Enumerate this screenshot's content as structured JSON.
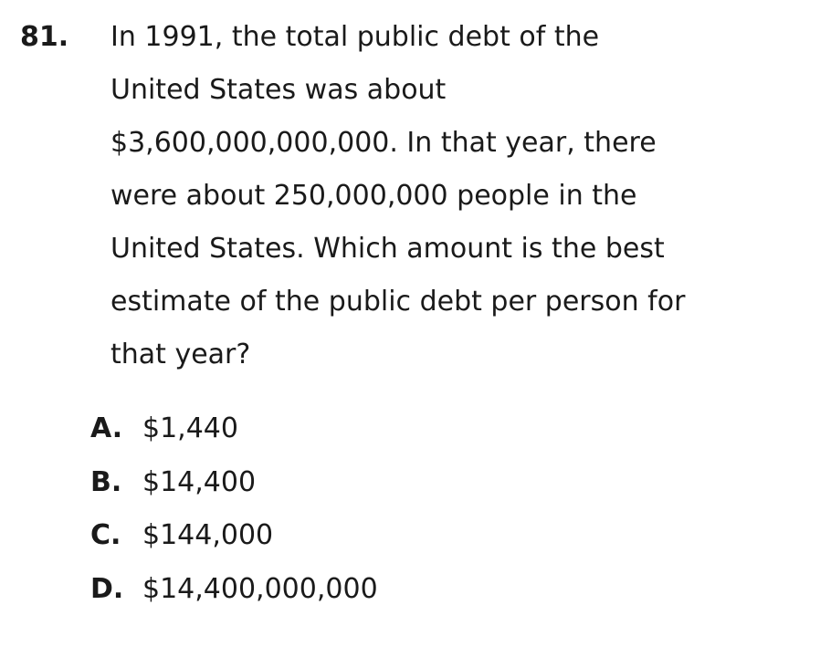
{
  "question": {
    "number": "81.",
    "lines": [
      "In 1991, the total public debt of the",
      "United States was about",
      "$3,600,000,000,000. In that year, there",
      "were about 250,000,000 people in the",
      "United States. Which amount is the best",
      "estimate of the public debt per person for",
      "that year?"
    ],
    "options": [
      {
        "letter": "A.",
        "text": "$1,440"
      },
      {
        "letter": "B.",
        "text": "$14,400"
      },
      {
        "letter": "C.",
        "text": "$144,000"
      },
      {
        "letter": "D.",
        "text": "$14,400,000,000"
      }
    ]
  }
}
